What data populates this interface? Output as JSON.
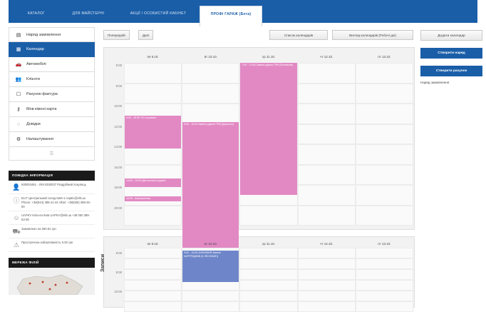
{
  "topnav": {
    "tabs": [
      {
        "label": "КАТАЛОГ"
      },
      {
        "label": "ДЛЯ МАЙСТЕРНІ"
      },
      {
        "label": "АКЦІЇ / ОСОБИСТИЙ КАБІНЕТ"
      },
      {
        "label": "ПРОФІ ГАРАЖ (Бета)"
      }
    ]
  },
  "sidebar": {
    "items": [
      {
        "label": "Наряд замовлення",
        "icon": "document-icon"
      },
      {
        "label": "Календар",
        "icon": "calendar-icon"
      },
      {
        "label": "Автомобілі",
        "icon": "car-icon"
      },
      {
        "label": "Клієнти",
        "icon": "users-icon"
      },
      {
        "label": "Рахунок-фактура",
        "icon": "invoice-icon"
      },
      {
        "label": "Мов кімнні карта",
        "icon": "key-icon"
      },
      {
        "label": "Довідки",
        "icon": "chat-icon"
      },
      {
        "label": "Налаштування",
        "icon": "gear-icon"
      }
    ],
    "more": "☰",
    "info_head": "ПОМІДКА ІНФОРМАЦІЯ",
    "info": [
      {
        "text": "К00001651 - ЛКУ4330037 Роздрібний покупець"
      },
      {
        "text": "ELIT Центральний склад Київ-1 сервіс@elit.ua Phone: +38(044) 389-41-44 Viber: +38(050) 389-45-00"
      },
      {
        "text": "UAPKV Клієнти Київ UAPKV@elit.ua +38 050 389-53-38"
      },
      {
        "text": "Замовлено на 250.61 грн"
      },
      {
        "text": "Прострочена заборгованість 0.00 грн"
      }
    ],
    "map_head": "МЕРЕЖА ФІЛІЙ"
  },
  "toolbar": {
    "prev": "Попередній",
    "today": "Далі",
    "list_calendars": "Список календарів",
    "view_calendars": "Вигляд календарів (Робочі дні)"
  },
  "right_panel": {
    "add_calendar": "Додати календар",
    "create_order": "Створити наряд",
    "create_invoice": "Створити рахунок",
    "orders_label": "Наряд замовлення"
  },
  "calendar1": {
    "days": [
      "пн 9.10.",
      "вт 10.10.",
      "ср 11.10.",
      "чт 12.10.",
      "пт 13.10."
    ],
    "hours": [
      "9:00",
      "8:00",
      "10:00",
      "12:00",
      "14:00",
      "16:00",
      "18:00",
      "20:00"
    ],
    "events": [
      {
        "title": "9:00 - 10:30 ТО та ремонт",
        "day": 0,
        "start": 2.6,
        "end": 4.2
      },
      {
        "title": "14:00 - 15:00 Діагностика ходової",
        "day": 0,
        "start": 5.7,
        "end": 6.1
      },
      {
        "title": "15:30 - Шиномонтаж",
        "day": 0,
        "start": 6.55,
        "end": 6.8
      },
      {
        "title": "9:00 - 15:00 Заміна рідини ГРМ (Дизельні)",
        "day": 1,
        "start": 2.9,
        "end": 10
      },
      {
        "title": "7:00 - 13:00 Заміна рідини ГРМ (Бензинові)",
        "day": 2,
        "start": 0,
        "end": 6.5
      }
    ]
  },
  "calendar2": {
    "label": "Записи",
    "days": [
      "пн 9.10.",
      "вт 10.10.",
      "ср 11.10.",
      "чт 12.10.",
      "пт 13.10."
    ],
    "hours": [
      "8:00",
      "9:00",
      "10:00"
    ],
    "events": [
      {
        "title": "9:00 - 10:30 АУКИЛКИЯ Заміна КАРТРИДЖІВ (К.ЛЕСЮКИН)",
        "day": 1
      }
    ]
  },
  "colors": {
    "primary": "#1a5ea8",
    "event_pink": "#e289c4",
    "event_blue": "#6e86c9"
  }
}
